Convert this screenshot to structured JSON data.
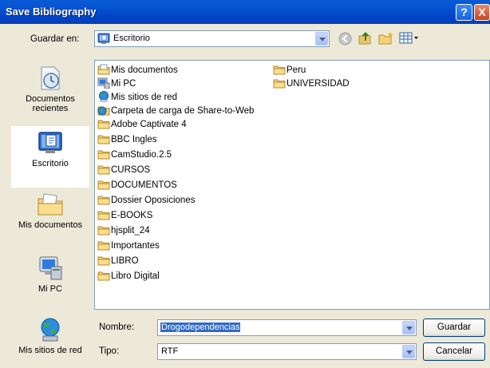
{
  "window": {
    "title": "Save Bibliography",
    "help_glyph": "?",
    "close_glyph": "X"
  },
  "location": {
    "label": "Guardar en:",
    "value": "Escritorio"
  },
  "toolbar": {
    "icons": [
      "back-icon",
      "up-folder-icon",
      "new-folder-icon",
      "view-menu-icon"
    ]
  },
  "places": [
    {
      "label_line1": "Documentos",
      "label_line2": "recientes",
      "icon": "recent-documents-icon"
    },
    {
      "label_line1": "Escritorio",
      "label_line2": "",
      "icon": "desktop-icon",
      "selected": true
    },
    {
      "label_line1": "Mis documentos",
      "label_line2": "",
      "icon": "my-documents-icon"
    },
    {
      "label_line1": "Mi PC",
      "label_line2": "",
      "icon": "my-computer-icon"
    },
    {
      "label_line1": "Mis sitios de red",
      "label_line2": "",
      "icon": "network-places-icon"
    }
  ],
  "files_col1": [
    {
      "name": "Mis documentos",
      "icon": "my-documents-icon"
    },
    {
      "name": "Mi PC",
      "icon": "my-computer-icon"
    },
    {
      "name": "Mis sitios de red",
      "icon": "network-places-icon"
    },
    {
      "name": "Carpeta de carga de Share-to-Web",
      "icon": "web-folder-icon"
    },
    {
      "name": "Adobe Captivate 4",
      "icon": "folder-icon"
    },
    {
      "name": "BBC Ingles",
      "icon": "folder-icon"
    },
    {
      "name": "CamStudio.2.5",
      "icon": "folder-icon"
    },
    {
      "name": "CURSOS",
      "icon": "folder-icon"
    },
    {
      "name": "DOCUMENTOS",
      "icon": "folder-icon"
    },
    {
      "name": "Dossier Oposiciones",
      "icon": "folder-icon"
    },
    {
      "name": "E-BOOKS",
      "icon": "folder-icon"
    },
    {
      "name": "hjsplit_24",
      "icon": "folder-icon"
    },
    {
      "name": "Importantes",
      "icon": "folder-icon"
    },
    {
      "name": "LIBRO",
      "icon": "folder-icon"
    },
    {
      "name": "Libro Digital",
      "icon": "folder-icon"
    }
  ],
  "files_col2": [
    {
      "name": "Peru",
      "icon": "folder-icon"
    },
    {
      "name": "UNIVERSIDAD",
      "icon": "folder-icon"
    }
  ],
  "filename": {
    "label": "Nombre:",
    "value": "Drogodependencias"
  },
  "filetype": {
    "label": "Tipo:",
    "value": "RTF"
  },
  "buttons": {
    "save": "Guardar",
    "cancel": "Cancelar"
  }
}
